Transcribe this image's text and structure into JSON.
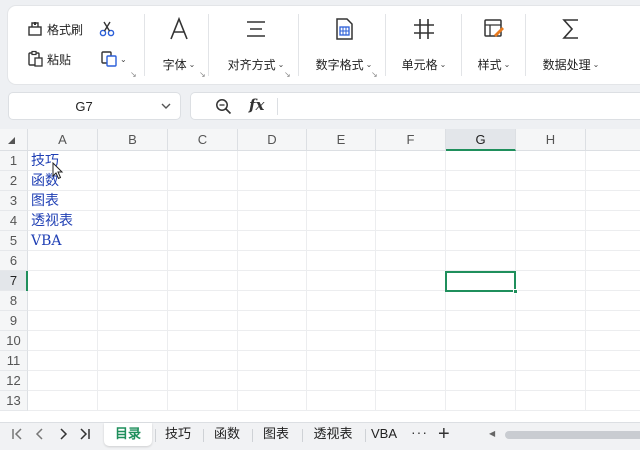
{
  "ribbon": {
    "clipboard": {
      "format_painter": "格式刷",
      "paste": "粘贴"
    },
    "font": {
      "label": "字体"
    },
    "alignment": {
      "label": "对齐方式"
    },
    "number_format": {
      "label": "数字格式"
    },
    "cells": {
      "label": "单元格"
    },
    "styles": {
      "label": "样式"
    },
    "data_processing": {
      "label": "数据处理"
    }
  },
  "formula_bar": {
    "name_box": "G7",
    "fx": "fx",
    "formula": ""
  },
  "grid": {
    "columns": [
      "A",
      "B",
      "C",
      "D",
      "E",
      "F",
      "G",
      "H"
    ],
    "rows": [
      "1",
      "2",
      "3",
      "4",
      "5",
      "6",
      "7",
      "8",
      "9",
      "10",
      "11",
      "12",
      "13"
    ],
    "selected_column": "G",
    "selected_row": "7",
    "cells": {
      "A1": "技巧",
      "A2": "函数",
      "A3": "图表",
      "A4": "透视表",
      "A5": "VBA"
    },
    "text_color": "#1f3fb4",
    "accent": "#1f8f5c"
  },
  "sheet_tabs": {
    "tabs": [
      "目录",
      "技巧",
      "函数",
      "图表",
      "透视表",
      "VBA"
    ],
    "active": "目录",
    "more": "···",
    "add": "+"
  }
}
